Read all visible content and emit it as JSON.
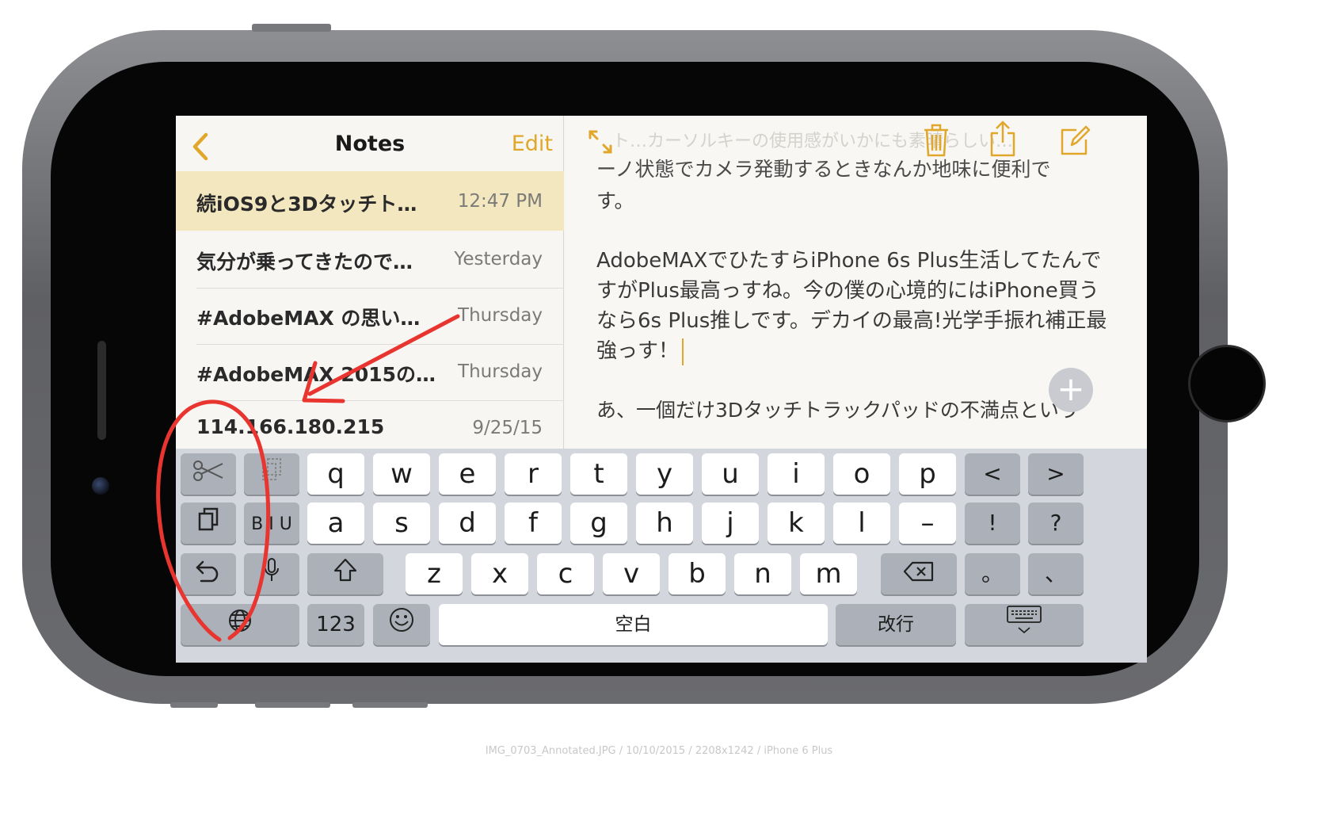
{
  "sidebar": {
    "title": "Notes",
    "edit_label": "Edit",
    "back_icon": "chevron-left-icon",
    "notes": [
      {
        "title": "続iOS9と3Dタッチト…",
        "time": "12:47 PM"
      },
      {
        "title": "気分が乗ってきたので…",
        "time": "Yesterday"
      },
      {
        "title": "#AdobeMAX の思い…",
        "time": "Thursday"
      },
      {
        "title": "#AdobeMAX 2015の…",
        "time": "Thursday"
      },
      {
        "title": "114.166.180.215",
        "time": "9/25/15"
      }
    ]
  },
  "editor": {
    "top_line": "ーノ状態でカメラ発動するときなんか地味に便利で",
    "paragraphs": [
      "す。",
      "",
      "AdobeMAXでひたすらiPhone 6s Plus生活してたんですがPlus最高っすね。今の僕の心境的にはiPhone買うなら6s Plus推しです。デカイの最高!光学手振れ補正最強っす！",
      "",
      "あ、一個だけ3Dタッチトラックパッドの不満点という"
    ],
    "ghost_heading": "ト…カーソルキーの使用感がいかにも素晴らしい…",
    "toolbar_icons": [
      "expand-icon",
      "trash-icon",
      "share-icon",
      "compose-icon"
    ],
    "add_button": "+"
  },
  "keyboard": {
    "row1": [
      "q",
      "w",
      "e",
      "r",
      "t",
      "y",
      "u",
      "i",
      "o",
      "p"
    ],
    "row2": [
      "a",
      "s",
      "d",
      "f",
      "g",
      "h",
      "j",
      "k",
      "l",
      "–"
    ],
    "row3": [
      "z",
      "x",
      "c",
      "v",
      "b",
      "n",
      "m"
    ],
    "left_icons": [
      "scissors-icon",
      "copy-icon",
      "paste-icon",
      "biu-icon",
      "undo-icon",
      "microphone-icon",
      "globe-icon"
    ],
    "biu_label": "B I U",
    "arrows": [
      "<",
      ">"
    ],
    "punct": [
      "!",
      "?",
      "。",
      "、"
    ],
    "numbers_label": "123",
    "space_label": "空白",
    "return_label": "改行"
  },
  "caption": "IMG_0703_Annotated.JPG / 10/10/2015 / 2208x1242 / iPhone 6 Plus",
  "colors": {
    "accent": "#e0a72a",
    "annotation": "#e8352f"
  }
}
